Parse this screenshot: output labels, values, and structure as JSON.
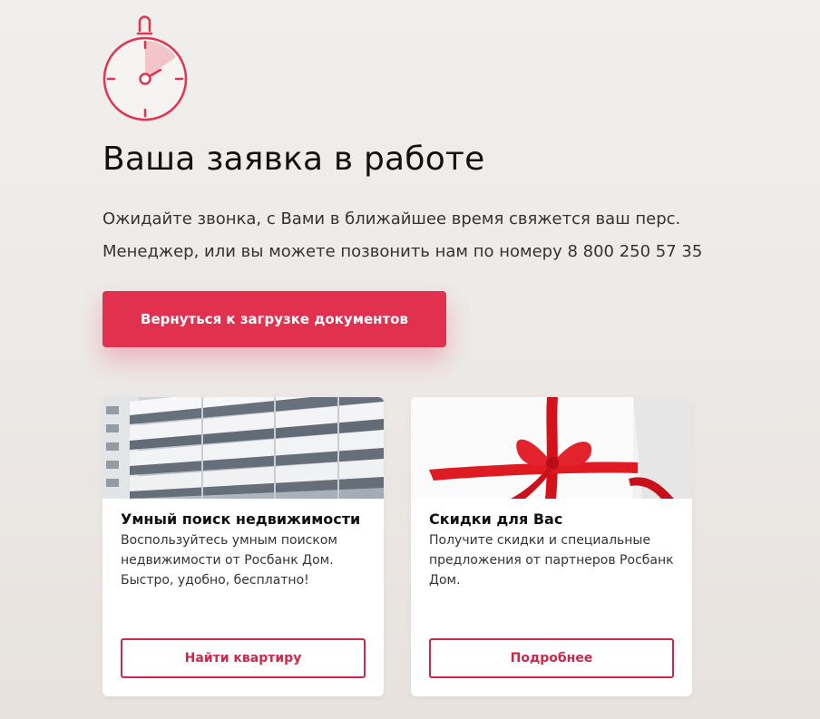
{
  "status": {
    "title": "Ваша заявка в работе",
    "line1": "Ожидайте звонка, с Вами в ближайшее время свяжется ваш перс.",
    "line2": "Менеджер, или вы можете позвонить нам по номеру 8 800 250 57 35",
    "back_button": "Вернуться к загрузке документов"
  },
  "cards": [
    {
      "title": "Умный поиск недвижимости",
      "text": "Воспользуйтесь умным поиском недвижимости от Росбанк Дом. Быстро, удобно, бесплатно!",
      "button": "Найти квартиру",
      "image": "building-facade"
    },
    {
      "title": "Скидки для Вас",
      "text": "Получите скидки и специальные предложения от партнеров Росбанк Дом.",
      "button": "Подробнее",
      "image": "gift-with-red-ribbon"
    }
  ],
  "colors": {
    "accent": "#e2304f",
    "outline": "#c9294a",
    "background": "#eeebe8"
  },
  "icons": {
    "status": "stopwatch-icon"
  }
}
